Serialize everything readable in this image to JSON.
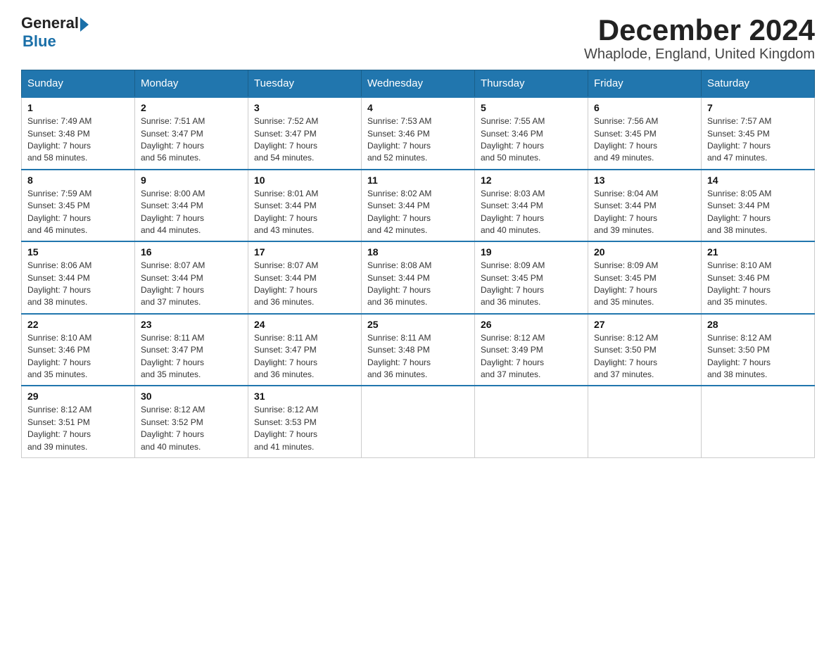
{
  "header": {
    "title": "December 2024",
    "subtitle": "Whaplode, England, United Kingdom",
    "logo_general": "General",
    "logo_blue": "Blue"
  },
  "days_of_week": [
    "Sunday",
    "Monday",
    "Tuesday",
    "Wednesday",
    "Thursday",
    "Friday",
    "Saturday"
  ],
  "weeks": [
    [
      {
        "day": "1",
        "sunrise": "7:49 AM",
        "sunset": "3:48 PM",
        "daylight": "7 hours and 58 minutes."
      },
      {
        "day": "2",
        "sunrise": "7:51 AM",
        "sunset": "3:47 PM",
        "daylight": "7 hours and 56 minutes."
      },
      {
        "day": "3",
        "sunrise": "7:52 AM",
        "sunset": "3:47 PM",
        "daylight": "7 hours and 54 minutes."
      },
      {
        "day": "4",
        "sunrise": "7:53 AM",
        "sunset": "3:46 PM",
        "daylight": "7 hours and 52 minutes."
      },
      {
        "day": "5",
        "sunrise": "7:55 AM",
        "sunset": "3:46 PM",
        "daylight": "7 hours and 50 minutes."
      },
      {
        "day": "6",
        "sunrise": "7:56 AM",
        "sunset": "3:45 PM",
        "daylight": "7 hours and 49 minutes."
      },
      {
        "day": "7",
        "sunrise": "7:57 AM",
        "sunset": "3:45 PM",
        "daylight": "7 hours and 47 minutes."
      }
    ],
    [
      {
        "day": "8",
        "sunrise": "7:59 AM",
        "sunset": "3:45 PM",
        "daylight": "7 hours and 46 minutes."
      },
      {
        "day": "9",
        "sunrise": "8:00 AM",
        "sunset": "3:44 PM",
        "daylight": "7 hours and 44 minutes."
      },
      {
        "day": "10",
        "sunrise": "8:01 AM",
        "sunset": "3:44 PM",
        "daylight": "7 hours and 43 minutes."
      },
      {
        "day": "11",
        "sunrise": "8:02 AM",
        "sunset": "3:44 PM",
        "daylight": "7 hours and 42 minutes."
      },
      {
        "day": "12",
        "sunrise": "8:03 AM",
        "sunset": "3:44 PM",
        "daylight": "7 hours and 40 minutes."
      },
      {
        "day": "13",
        "sunrise": "8:04 AM",
        "sunset": "3:44 PM",
        "daylight": "7 hours and 39 minutes."
      },
      {
        "day": "14",
        "sunrise": "8:05 AM",
        "sunset": "3:44 PM",
        "daylight": "7 hours and 38 minutes."
      }
    ],
    [
      {
        "day": "15",
        "sunrise": "8:06 AM",
        "sunset": "3:44 PM",
        "daylight": "7 hours and 38 minutes."
      },
      {
        "day": "16",
        "sunrise": "8:07 AM",
        "sunset": "3:44 PM",
        "daylight": "7 hours and 37 minutes."
      },
      {
        "day": "17",
        "sunrise": "8:07 AM",
        "sunset": "3:44 PM",
        "daylight": "7 hours and 36 minutes."
      },
      {
        "day": "18",
        "sunrise": "8:08 AM",
        "sunset": "3:44 PM",
        "daylight": "7 hours and 36 minutes."
      },
      {
        "day": "19",
        "sunrise": "8:09 AM",
        "sunset": "3:45 PM",
        "daylight": "7 hours and 36 minutes."
      },
      {
        "day": "20",
        "sunrise": "8:09 AM",
        "sunset": "3:45 PM",
        "daylight": "7 hours and 35 minutes."
      },
      {
        "day": "21",
        "sunrise": "8:10 AM",
        "sunset": "3:46 PM",
        "daylight": "7 hours and 35 minutes."
      }
    ],
    [
      {
        "day": "22",
        "sunrise": "8:10 AM",
        "sunset": "3:46 PM",
        "daylight": "7 hours and 35 minutes."
      },
      {
        "day": "23",
        "sunrise": "8:11 AM",
        "sunset": "3:47 PM",
        "daylight": "7 hours and 35 minutes."
      },
      {
        "day": "24",
        "sunrise": "8:11 AM",
        "sunset": "3:47 PM",
        "daylight": "7 hours and 36 minutes."
      },
      {
        "day": "25",
        "sunrise": "8:11 AM",
        "sunset": "3:48 PM",
        "daylight": "7 hours and 36 minutes."
      },
      {
        "day": "26",
        "sunrise": "8:12 AM",
        "sunset": "3:49 PM",
        "daylight": "7 hours and 37 minutes."
      },
      {
        "day": "27",
        "sunrise": "8:12 AM",
        "sunset": "3:50 PM",
        "daylight": "7 hours and 37 minutes."
      },
      {
        "day": "28",
        "sunrise": "8:12 AM",
        "sunset": "3:50 PM",
        "daylight": "7 hours and 38 minutes."
      }
    ],
    [
      {
        "day": "29",
        "sunrise": "8:12 AM",
        "sunset": "3:51 PM",
        "daylight": "7 hours and 39 minutes."
      },
      {
        "day": "30",
        "sunrise": "8:12 AM",
        "sunset": "3:52 PM",
        "daylight": "7 hours and 40 minutes."
      },
      {
        "day": "31",
        "sunrise": "8:12 AM",
        "sunset": "3:53 PM",
        "daylight": "7 hours and 41 minutes."
      },
      null,
      null,
      null,
      null
    ]
  ],
  "labels": {
    "sunrise": "Sunrise:",
    "sunset": "Sunset:",
    "daylight": "Daylight: 7 hours"
  }
}
